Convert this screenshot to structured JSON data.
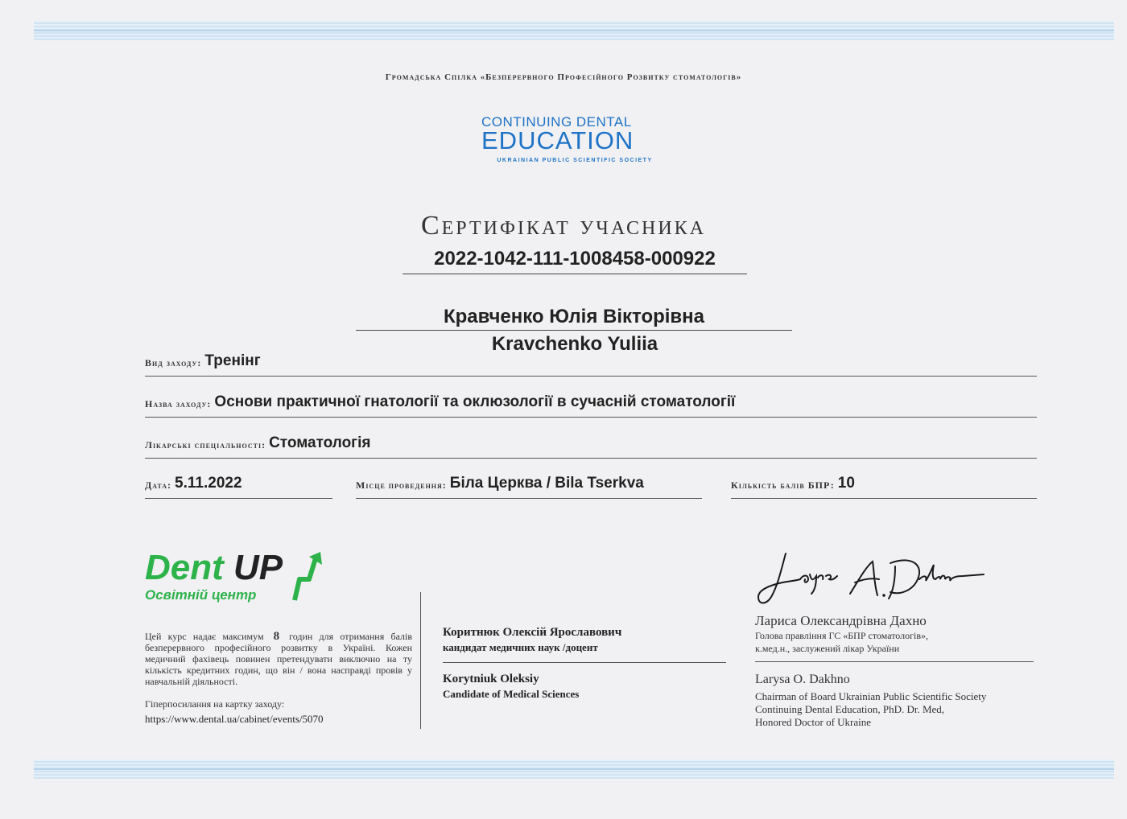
{
  "organization": "Громадська Спілка «Безперервного Професійного Розвитку стоматологів»",
  "logo_cde": {
    "line1": "CONTINUING DENTAL",
    "line2": "EDUCATION",
    "line3": "UKRAINIAN PUBLIC SCIENTIFIC SOCIETY"
  },
  "certificate": {
    "title": "Сертифікат учасника",
    "number": "2022-1042-111-1008458-000922"
  },
  "participant": {
    "name_ua": "Кравченко Юлія Вікторівна",
    "name_en": "Kravchenko Yuliia"
  },
  "fields": {
    "event_type": {
      "label": "Вид заходу:",
      "value": "Тренінг"
    },
    "event_name": {
      "label": "Назва заходу:",
      "value": "Основи практичної гнатології та оклюзології в сучасній стоматології"
    },
    "specialties": {
      "label": "Лікарські спеціальності:",
      "value": "Стоматологія"
    },
    "date": {
      "label": "Дата:",
      "value": "5.11.2022"
    },
    "location": {
      "label": "Місце проведення:",
      "value": "Біла Церква / Bila Tserkva"
    },
    "points": {
      "label": "Кількість балів БПР:",
      "value": "10"
    }
  },
  "dent_up": {
    "brand_part1": "Dent ",
    "brand_part2": "UP",
    "subtitle": "Освітній центр",
    "colors": {
      "green": "#2db34a",
      "dark": "#222222"
    }
  },
  "course_note": {
    "text_before": "Цей курс надає максимум",
    "hours": "8",
    "text_after": "годин для отримання балів безперервного професійного розвитку в Україні. Кожен медичний фахівець повинен претендувати виключно на ту кількість кредитних годин, що він / вона насправді провів у навчальній діяльності."
  },
  "event_link": {
    "label": "Гіперпосилання на картку заходу:",
    "url": "https://www.dental.ua/cabinet/events/5070"
  },
  "lecturer": {
    "name_ua": "Коритнюк Олексій Ярославович",
    "title_ua": "кандидат медичних наук /доцент",
    "name_en": "Korytniuk Oleksiy",
    "title_en": "Candidate of Medical Sciences"
  },
  "head": {
    "signature_text": "Larysa A. Dakhno",
    "name_ua": "Лариса Олександрівна Дахно",
    "title_ua_1": "Голова правління ГС «БПР стоматологів»,",
    "title_ua_2": "к.мед.н., заслужений лікар України",
    "name_en": "Larysa O. Dakhno",
    "title_en_1": "Chairman of Board Ukrainian Public Scientific Society",
    "title_en_2": "Continuing Dental Education, PhD. Dr. Med,",
    "title_en_3": "Honored Doctor of Ukraine"
  }
}
